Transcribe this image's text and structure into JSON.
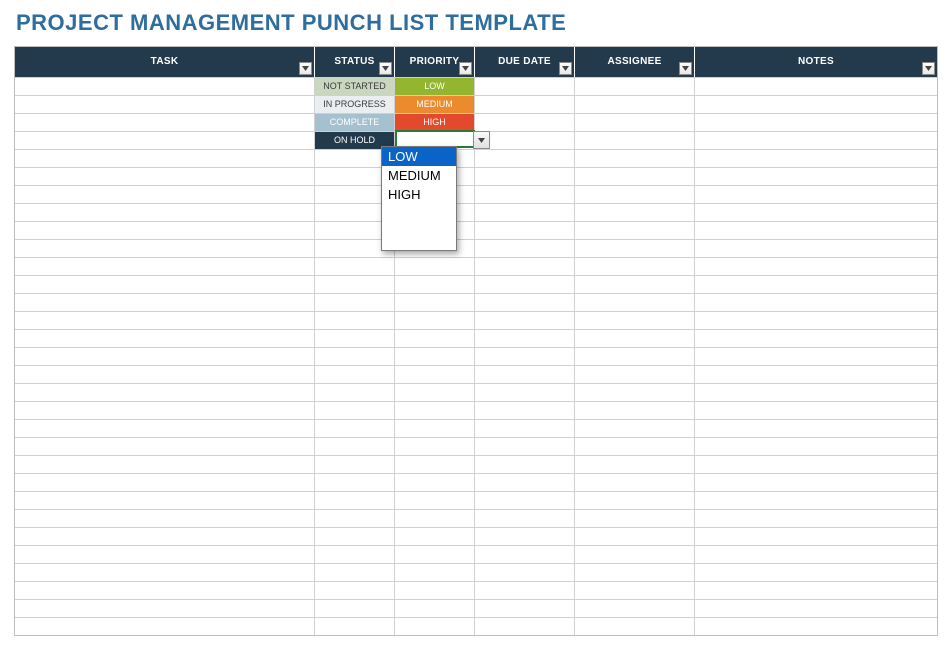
{
  "title": "PROJECT MANAGEMENT PUNCH LIST TEMPLATE",
  "columns": {
    "task": "TASK",
    "status": "STATUS",
    "priority": "PRIORITY",
    "duedate": "DUE DATE",
    "assignee": "ASSIGNEE",
    "notes": "NOTES"
  },
  "status_values": {
    "not_started": "NOT STARTED",
    "in_progress": "IN PROGRESS",
    "complete": "COMPLETE",
    "on_hold": "ON HOLD"
  },
  "priority_values": {
    "low": "LOW",
    "medium": "MEDIUM",
    "high": "HIGH"
  },
  "dropdown": {
    "options": [
      "LOW",
      "MEDIUM",
      "HIGH"
    ],
    "selected": "LOW"
  },
  "rows_total": 31,
  "colors": {
    "header_bg": "#233a4d",
    "title": "#2e6e9e",
    "status_notstarted": "#c9d6c0",
    "status_inprogress": "#eaeef0",
    "status_complete": "#a5c0cf",
    "status_onhold": "#233a4d",
    "prio_low": "#93b52f",
    "prio_medium": "#eb8b2d",
    "prio_high": "#e24a2b",
    "dropdown_selected": "#0a63c7"
  }
}
